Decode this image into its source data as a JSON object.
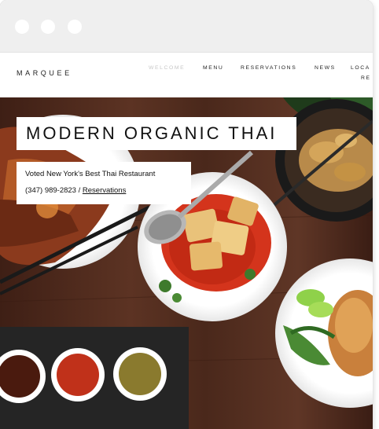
{
  "browser": {
    "controls": [
      "window-dot",
      "window-dot",
      "window-dot"
    ]
  },
  "site": {
    "brand": "MARQUEE",
    "nav": {
      "items": [
        "WELCOME",
        "MENU",
        "RESERVATIONS",
        "NEWS",
        "LOCA"
      ],
      "overflow_text": "RE",
      "active": "WELCOME"
    }
  },
  "hero": {
    "headline": "MODERN ORGANIC THAI",
    "tagline": "Voted New York's Best Thai Restaurant",
    "phone": "(347) 989-2823",
    "separator": " / ",
    "reservations_link": "Reservations"
  },
  "colors": {
    "chrome": "#efefef",
    "nav_text": "#222222",
    "nav_active": "#c7c7c7",
    "hero_wood": "#4b2a1d",
    "sauce_red": "#d4341c"
  }
}
